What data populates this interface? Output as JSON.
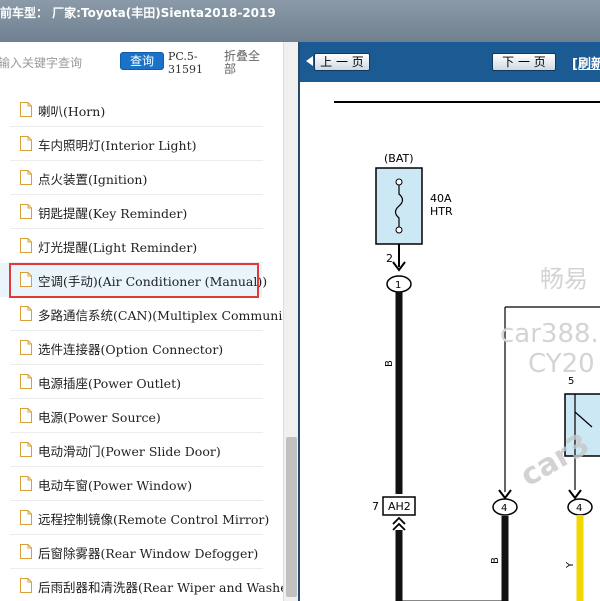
{
  "header": {
    "title": "前车型：  厂家:Toyota(丰田)Sienta2018-2019"
  },
  "search": {
    "placeholder": "输入关键字查询",
    "query_label": "查询",
    "code": "PC.5-31591",
    "collapse_label": "折叠全部"
  },
  "tree": {
    "selected_index": 5,
    "items": [
      {
        "label": "喇叭(Horn)"
      },
      {
        "label": "车内照明灯(Interior Light)"
      },
      {
        "label": "点火装置(Ignition)"
      },
      {
        "label": "钥匙提醒(Key Reminder)"
      },
      {
        "label": "灯光提醒(Light Reminder)"
      },
      {
        "label": "空调(手动)(Air Conditioner (Manual))"
      },
      {
        "label": "多路通信系统(CAN)(Multiplex Communication System)"
      },
      {
        "label": "选件连接器(Option Connector)"
      },
      {
        "label": "电源插座(Power Outlet)"
      },
      {
        "label": "电源(Power Source)"
      },
      {
        "label": "电动滑动门(Power Slide Door)"
      },
      {
        "label": "电动车窗(Power Window)"
      },
      {
        "label": "远程控制镜像(Remote Control Mirror)"
      },
      {
        "label": "后窗除雾器(Rear Window Defogger)"
      },
      {
        "label": "后雨刮器和清洗器(Rear Wiper and Washer)"
      }
    ]
  },
  "viewer": {
    "prev_label": "上 一 页",
    "next_label": "下 一 页",
    "refresh_label": "[刷新",
    "diagram": {
      "bat_label": "(BAT)",
      "fuse_rating": "40A",
      "fuse_name": "HTR",
      "pin_2": "2",
      "conn_1": "1",
      "wire_b_1": "B",
      "conn_7": "7",
      "conn_ah2": "AH2",
      "conn_4a": "4",
      "conn_4b": "4",
      "wire_b_2": "B",
      "wire_y": "Y",
      "pin_5": "5",
      "watermark_1": "畅易",
      "watermark_2": "car388.",
      "watermark_3": "CY20",
      "watermark_4": "car3"
    }
  },
  "colors": {
    "accent": "#1c5a93",
    "highlight": "#e03a3a",
    "fuse_fill": "#cde8f5",
    "wire_yellow": "#f0d800"
  }
}
